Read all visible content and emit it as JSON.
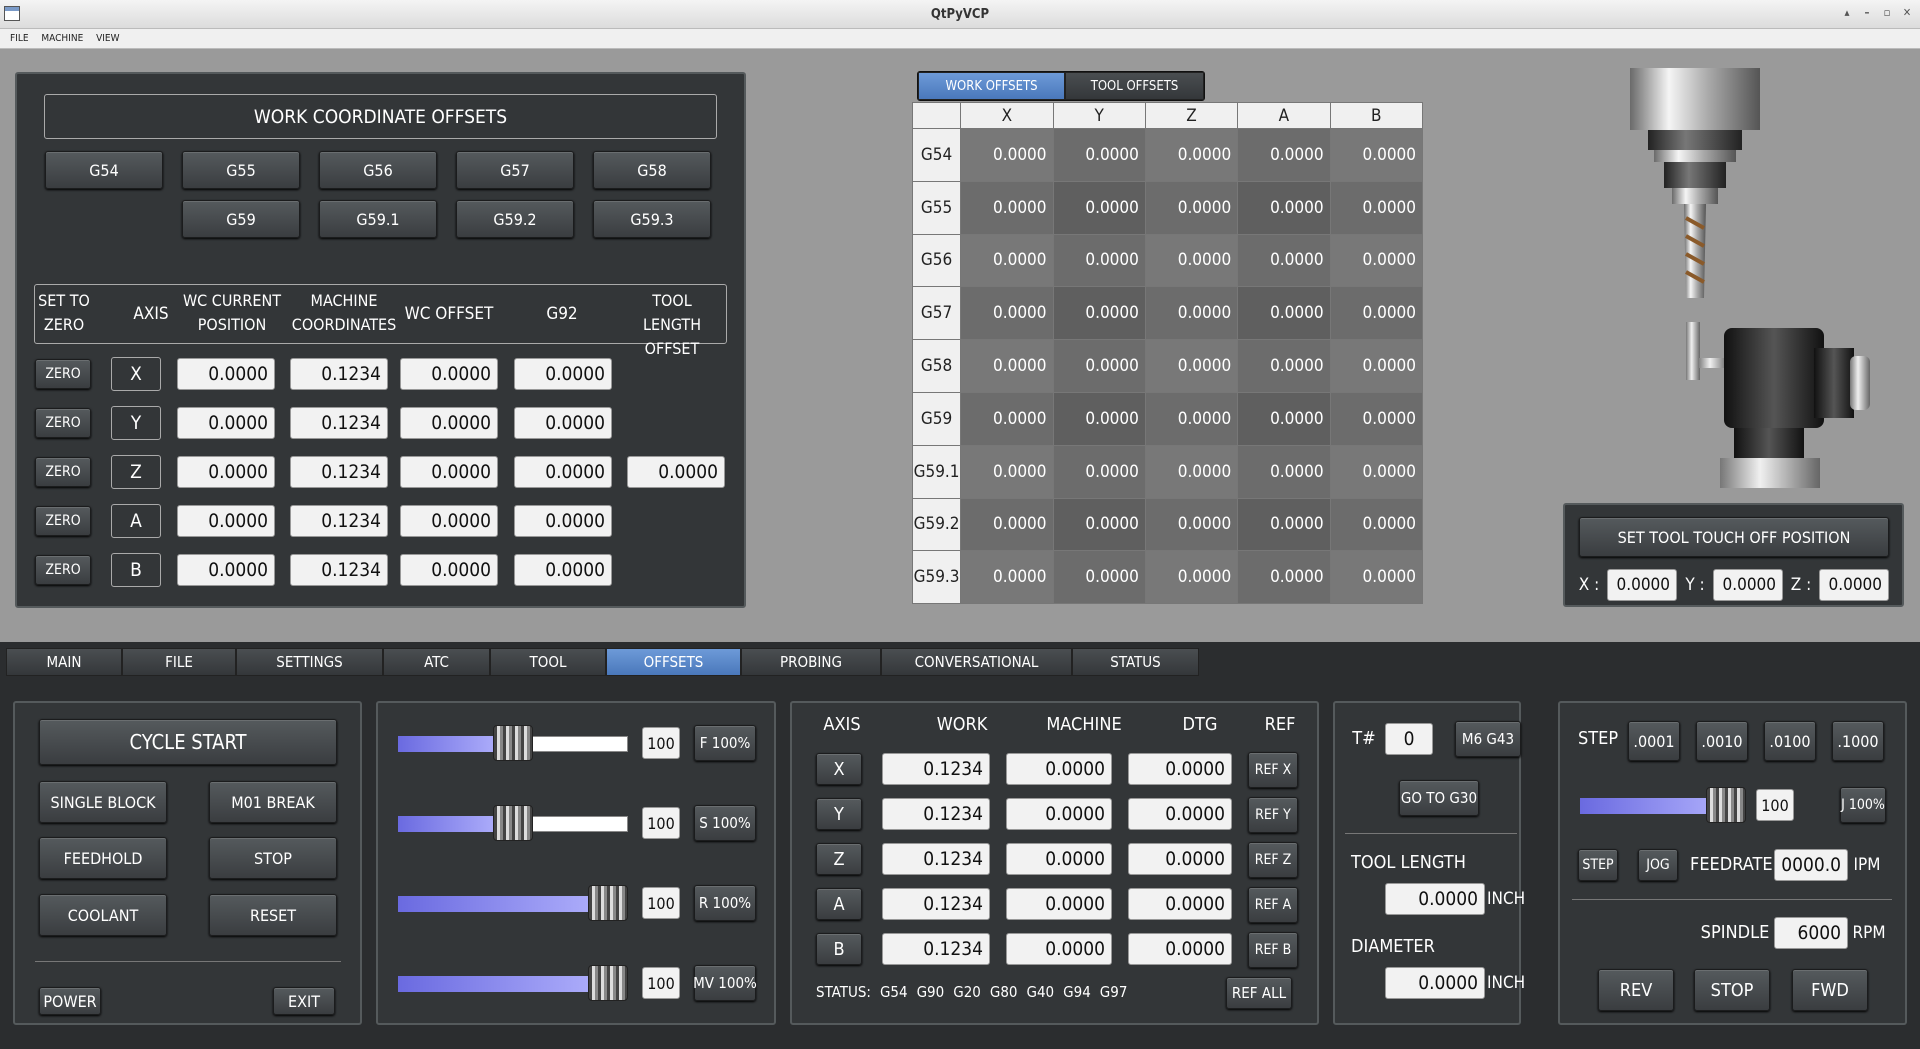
{
  "window": {
    "title": "QtPyVCP"
  },
  "menu": [
    "FILE",
    "MACHINE",
    "VIEW"
  ],
  "wco": {
    "title": "WORK COORDINATE OFFSETS",
    "buttons": [
      "G54",
      "G55",
      "G56",
      "G57",
      "G58",
      "G59",
      "G59.1",
      "G59.2",
      "G59.3"
    ],
    "headers": {
      "set_zero": "SET TO ZERO",
      "axis": "AXIS",
      "wc_current": "WC CURRENT POSITION",
      "machine": "MACHINE COORDINATES",
      "wc_offset": "WC OFFSET",
      "g92": "G92",
      "tool_length": "TOOL LENGTH OFFSET"
    },
    "zero_label": "ZERO",
    "rows": [
      {
        "axis": "X",
        "current": "0.0000",
        "machine": "0.1234",
        "offset": "0.0000",
        "g92": "0.0000"
      },
      {
        "axis": "Y",
        "current": "0.0000",
        "machine": "0.1234",
        "offset": "0.0000",
        "g92": "0.0000"
      },
      {
        "axis": "Z",
        "current": "0.0000",
        "machine": "0.1234",
        "offset": "0.0000",
        "g92": "0.0000",
        "tool_length": "0.0000"
      },
      {
        "axis": "A",
        "current": "0.0000",
        "machine": "0.1234",
        "offset": "0.0000",
        "g92": "0.0000"
      },
      {
        "axis": "B",
        "current": "0.0000",
        "machine": "0.1234",
        "offset": "0.0000",
        "g92": "0.0000"
      }
    ]
  },
  "offset_tabs": [
    "WORK OFFSETS",
    "TOOL OFFSETS"
  ],
  "offset_table": {
    "columns": [
      "X",
      "Y",
      "Z",
      "A",
      "B"
    ],
    "rows": [
      {
        "name": "G54",
        "values": [
          "0.0000",
          "0.0000",
          "0.0000",
          "0.0000",
          "0.0000"
        ]
      },
      {
        "name": "G55",
        "values": [
          "0.0000",
          "0.0000",
          "0.0000",
          "0.0000",
          "0.0000"
        ]
      },
      {
        "name": "G56",
        "values": [
          "0.0000",
          "0.0000",
          "0.0000",
          "0.0000",
          "0.0000"
        ]
      },
      {
        "name": "G57",
        "values": [
          "0.0000",
          "0.0000",
          "0.0000",
          "0.0000",
          "0.0000"
        ]
      },
      {
        "name": "G58",
        "values": [
          "0.0000",
          "0.0000",
          "0.0000",
          "0.0000",
          "0.0000"
        ]
      },
      {
        "name": "G59",
        "values": [
          "0.0000",
          "0.0000",
          "0.0000",
          "0.0000",
          "0.0000"
        ]
      },
      {
        "name": "G59.1",
        "values": [
          "0.0000",
          "0.0000",
          "0.0000",
          "0.0000",
          "0.0000"
        ]
      },
      {
        "name": "G59.2",
        "values": [
          "0.0000",
          "0.0000",
          "0.0000",
          "0.0000",
          "0.0000"
        ]
      },
      {
        "name": "G59.3",
        "values": [
          "0.0000",
          "0.0000",
          "0.0000",
          "0.0000",
          "0.0000"
        ]
      }
    ]
  },
  "touchoff": {
    "button": "SET TOOL TOUCH OFF POSITION",
    "x_label": "X :",
    "x": "0.0000",
    "y_label": "Y :",
    "y": "0.0000",
    "z_label": "Z :",
    "z": "0.0000"
  },
  "main_tabs": [
    "MAIN",
    "FILE",
    "SETTINGS",
    "ATC",
    "TOOL",
    "OFFSETS",
    "PROBING",
    "CONVERSATIONAL",
    "STATUS"
  ],
  "control": {
    "cycle_start": "CYCLE START",
    "single_block": "SINGLE BLOCK",
    "m01_break": "M01 BREAK",
    "feedhold": "FEEDHOLD",
    "stop": "STOP",
    "coolant": "COOLANT",
    "reset": "RESET",
    "power": "POWER",
    "exit": "EXIT"
  },
  "overrides": [
    {
      "value": "100",
      "button": "F 100%",
      "level": 0.5
    },
    {
      "value": "100",
      "button": "S 100%",
      "level": 0.5
    },
    {
      "value": "100",
      "button": "R 100%",
      "level": 1.0
    },
    {
      "value": "100",
      "button": "MV 100%",
      "level": 1.0
    }
  ],
  "dro": {
    "headers": [
      "AXIS",
      "WORK",
      "MACHINE",
      "DTG",
      "REF"
    ],
    "rows": [
      {
        "axis": "X",
        "work": "0.1234",
        "machine": "0.0000",
        "dtg": "0.0000",
        "ref": "REF X"
      },
      {
        "axis": "Y",
        "work": "0.1234",
        "machine": "0.0000",
        "dtg": "0.0000",
        "ref": "REF Y"
      },
      {
        "axis": "Z",
        "work": "0.1234",
        "machine": "0.0000",
        "dtg": "0.0000",
        "ref": "REF Z"
      },
      {
        "axis": "A",
        "work": "0.1234",
        "machine": "0.0000",
        "dtg": "0.0000",
        "ref": "REF A"
      },
      {
        "axis": "B",
        "work": "0.1234",
        "machine": "0.0000",
        "dtg": "0.0000",
        "ref": "REF B"
      }
    ],
    "status_label": "STATUS:",
    "status_codes": [
      "G54",
      "G90",
      "G20",
      "G80",
      "G40",
      "G94",
      "G97"
    ],
    "ref_all": "REF ALL"
  },
  "tool": {
    "t_label": "T#",
    "t_value": "0",
    "m6": "M6 G43",
    "go_g30": "GO TO G30",
    "length_label": "TOOL LENGTH",
    "length": "0.0000",
    "length_unit": "INCH",
    "diameter_label": "DIAMETER",
    "diameter": "0.0000",
    "diameter_unit": "INCH"
  },
  "jog": {
    "step_label": "STEP",
    "steps": [
      ".0001",
      ".0010",
      ".0100",
      ".1000"
    ],
    "jog_value": "100",
    "jog_button": "J 100%",
    "jog_level": 1.0,
    "step_button": "STEP",
    "jog_mode": "JOG",
    "feedrate_label": "FEEDRATE",
    "feedrate": "0000.0",
    "feedrate_unit": "IPM",
    "spindle_label": "SPINDLE",
    "spindle": "6000",
    "spindle_unit": "RPM",
    "rev": "REV",
    "stop": "STOP",
    "fwd": "FWD"
  }
}
